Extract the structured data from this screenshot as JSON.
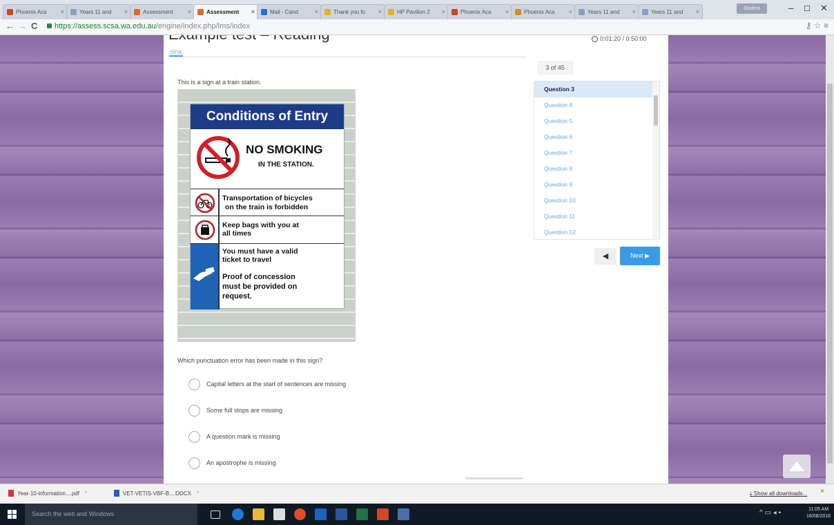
{
  "browser": {
    "tabs": [
      {
        "label": "Phoenix Aca",
        "favicon_color": "#c7462e",
        "active": false
      },
      {
        "label": "Years 11 and",
        "favicon_color": "#8aa0c0",
        "active": false
      },
      {
        "label": "Assessment",
        "favicon_color": "#d66a2a",
        "active": false
      },
      {
        "label": "Assessment",
        "favicon_color": "#d66a2a",
        "active": true
      },
      {
        "label": "Mail - Cand",
        "favicon_color": "#2a6fd6",
        "active": false
      },
      {
        "label": "Thank you fo",
        "favicon_color": "#e0b030",
        "active": false
      },
      {
        "label": "HP Pavilion 2",
        "favicon_color": "#e0b030",
        "active": false
      },
      {
        "label": "Phoenix Aca",
        "favicon_color": "#c7462e",
        "active": false
      },
      {
        "label": "Phoenix Aca",
        "favicon_color": "#d09020",
        "active": false
      },
      {
        "label": "Years 11 and",
        "favicon_color": "#8aa0c0",
        "active": false
      },
      {
        "label": "Years 11 and",
        "favicon_color": "#8aa0c0",
        "active": false
      }
    ],
    "url_host": "https://assess.scsa.wa.edu.au",
    "url_path": "/engine/index.php/lms/index",
    "user_label": "Student"
  },
  "test": {
    "title": "Example test – Reading",
    "subtab": "olna",
    "timer": "0:01:20 / 0:50:00",
    "prompt": "This is a sign at a train station.",
    "question": "Which punctuation error has been made in this sign?",
    "options": [
      "Capital letters at the start of sentences are missing",
      "Some full stops are missing",
      "A question mark is missing",
      "An apostrophe is missing"
    ]
  },
  "sign": {
    "header": "Conditions of Entry",
    "no_smoking": "NO SMOKING",
    "station": "IN THE STATION.",
    "bicycles_line1": "Transportation of bicycles",
    "bicycles_line2": "on the train is forbidden",
    "bags_line1": "Keep bags with you at",
    "bags_line2": "all times",
    "ticket_line1": "You must have a valid",
    "ticket_line2": "ticket to travel",
    "concession_line1": "Proof of concession",
    "concession_line2": "must be provided on",
    "concession_line3": "request."
  },
  "navigator": {
    "counter": "3 of 45",
    "current": "Question 3",
    "questions": [
      "Question 3",
      "Question 4",
      "Question 5",
      "Question 6",
      "Question 7",
      "Question 8",
      "Question 9",
      "Question 10",
      "Question 11",
      "Question 12"
    ],
    "prev_label": "◀",
    "next_label": "Next"
  },
  "downloads": {
    "items": [
      {
        "label": "Year-10-information....pdf",
        "color": "#d33"
      },
      {
        "label": "VET-VETIS-VBF-B....DOCX",
        "color": "#2b5fb8"
      }
    ],
    "show_all": "Show all downloads...",
    "close": "×"
  },
  "taskbar": {
    "search_placeholder": "Search the web and Windows",
    "time": "11:05 AM",
    "date": "16/08/2016"
  },
  "colors": {
    "accent_blue": "#3b9ae6",
    "sign_blue": "#1d3b87",
    "background_purple": "#8b6aa2"
  }
}
